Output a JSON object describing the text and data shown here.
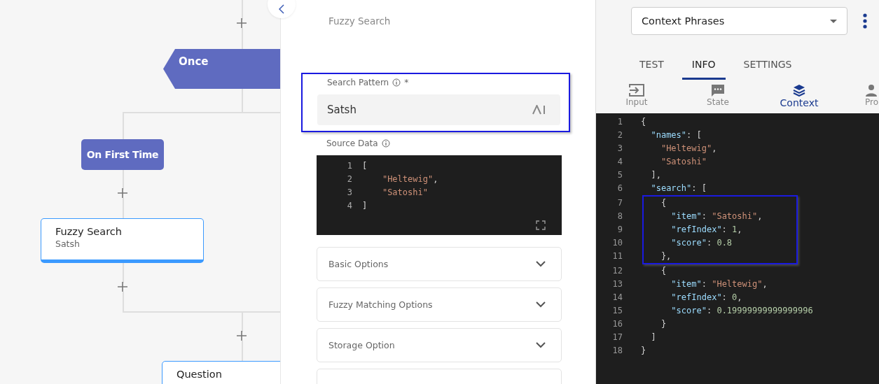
{
  "flow": {
    "nodes": [
      {
        "kind": "trigger",
        "title": "Once"
      },
      {
        "kind": "branch",
        "title": "On First Time"
      },
      {
        "kind": "node",
        "title": "Fuzzy Search",
        "subtitle": "Satsh",
        "selected": true
      },
      {
        "kind": "node",
        "title": "Question",
        "selected": false
      }
    ]
  },
  "edit_panel": {
    "subtitle": "Fuzzy Search",
    "search_pattern": {
      "label": "Search Pattern",
      "required": "*",
      "value": "Satsh",
      "highlighted": true
    },
    "source_data": {
      "label": "Source Data",
      "lines": [
        {
          "n": "1",
          "text": "["
        },
        {
          "n": "2",
          "text": "    \"Heltewig\","
        },
        {
          "n": "3",
          "text": "    \"Satoshi\""
        },
        {
          "n": "4",
          "text": "]"
        }
      ]
    },
    "sections": [
      {
        "kind": "section",
        "title": "Basic Options",
        "expanded": false
      },
      {
        "kind": "section",
        "title": "Fuzzy Matching Options",
        "expanded": false
      },
      {
        "kind": "section",
        "title": "Storage Option",
        "expanded": false
      },
      {
        "kind": "blank"
      }
    ]
  },
  "info_panel": {
    "dropdown": {
      "value": "Context Phrases"
    },
    "tabs": [
      {
        "label": "TEST",
        "selected": false
      },
      {
        "label": "INFO",
        "selected": true
      },
      {
        "label": "SETTINGS",
        "selected": false
      }
    ],
    "subtabs": [
      {
        "label": "Input",
        "kind": "input",
        "selected": false
      },
      {
        "label": "State",
        "kind": "state",
        "selected": false
      },
      {
        "label": "Context",
        "kind": "context",
        "selected": true
      },
      {
        "label": "Pro",
        "kind": "profile",
        "selected": false
      }
    ],
    "code": [
      {
        "n": "1",
        "highlighted": false,
        "text": "{"
      },
      {
        "n": "2",
        "highlighted": false,
        "text": "  \"names\": ["
      },
      {
        "n": "3",
        "highlighted": false,
        "text": "    \"Heltewig\","
      },
      {
        "n": "4",
        "highlighted": false,
        "text": "    \"Satoshi\""
      },
      {
        "n": "5",
        "highlighted": false,
        "text": "  ],"
      },
      {
        "n": "6",
        "highlighted": false,
        "text": "  \"search\": ["
      },
      {
        "n": "7",
        "highlighted": true,
        "text": "    {"
      },
      {
        "n": "8",
        "highlighted": true,
        "text": "      \"item\": \"Satoshi\","
      },
      {
        "n": "9",
        "highlighted": true,
        "text": "      \"refIndex\": 1,"
      },
      {
        "n": "10",
        "highlighted": true,
        "text": "      \"score\": 0.8"
      },
      {
        "n": "11",
        "highlighted": true,
        "text": "    },"
      },
      {
        "n": "12",
        "highlighted": false,
        "text": "    {"
      },
      {
        "n": "13",
        "highlighted": false,
        "text": "      \"item\": \"Heltewig\","
      },
      {
        "n": "14",
        "highlighted": false,
        "text": "      \"refIndex\": 0,"
      },
      {
        "n": "15",
        "highlighted": false,
        "text": "      \"score\": 0.19999999999999996"
      },
      {
        "n": "16",
        "highlighted": false,
        "text": "    }"
      },
      {
        "n": "17",
        "highlighted": false,
        "text": "  ]"
      },
      {
        "n": "18",
        "highlighted": false,
        "text": "}"
      }
    ]
  }
}
